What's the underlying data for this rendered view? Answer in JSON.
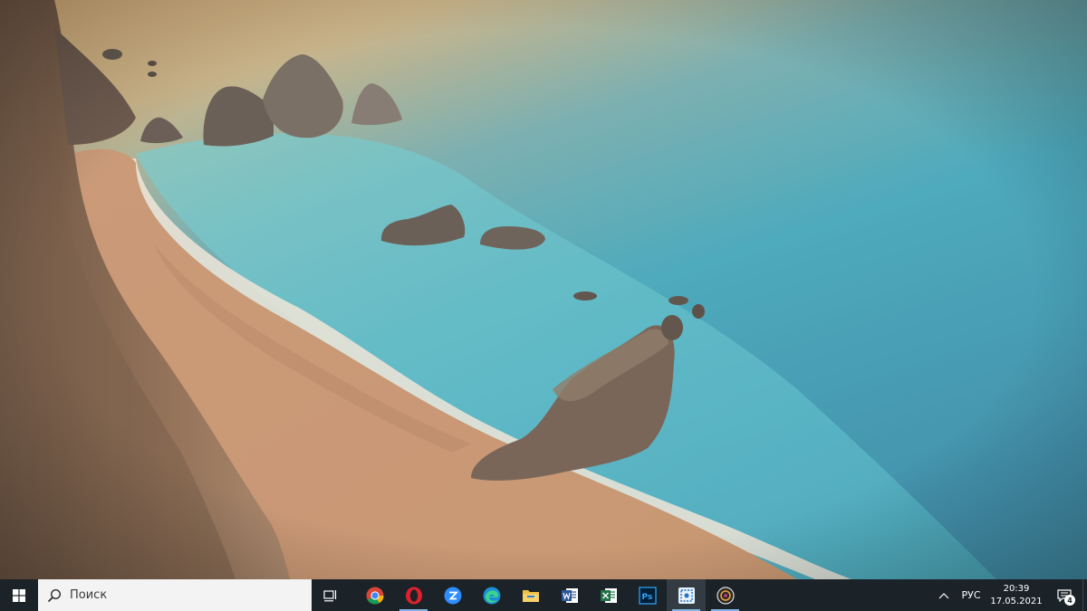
{
  "desktop": {
    "wallpaper": "beach-cove-wallpaper"
  },
  "taskbar": {
    "start_icon": "windows-logo-icon",
    "search": {
      "placeholder": "Поиск",
      "icon": "search-icon"
    },
    "task_view_icon": "task-view-icon",
    "apps": [
      {
        "name": "Google Chrome",
        "icon": "chrome-icon",
        "state": "idle"
      },
      {
        "name": "Opera",
        "icon": "opera-icon",
        "state": "running"
      },
      {
        "name": "Zoom",
        "icon": "zoom-icon",
        "state": "idle"
      },
      {
        "name": "Microsoft Edge",
        "icon": "edge-icon",
        "state": "idle"
      },
      {
        "name": "File Explorer",
        "icon": "folder-icon",
        "state": "idle"
      },
      {
        "name": "Microsoft Word",
        "icon": "word-icon",
        "state": "idle"
      },
      {
        "name": "Microsoft Excel",
        "icon": "excel-icon",
        "state": "idle"
      },
      {
        "name": "Adobe Photoshop",
        "icon": "photoshop-icon",
        "state": "idle"
      },
      {
        "name": "Snipping Tool",
        "icon": "snip-icon",
        "state": "focused"
      },
      {
        "name": "Media Player",
        "icon": "media-disc-icon",
        "state": "running"
      }
    ],
    "tray": {
      "chevron_icon": "chevron-up-icon",
      "language": "РУС",
      "time": "20:39",
      "date": "17.05.2021",
      "notifications_icon": "notifications-icon",
      "notifications_count": "4"
    },
    "accent_color": "#7fb4e6",
    "background_color": "#1b2328"
  }
}
